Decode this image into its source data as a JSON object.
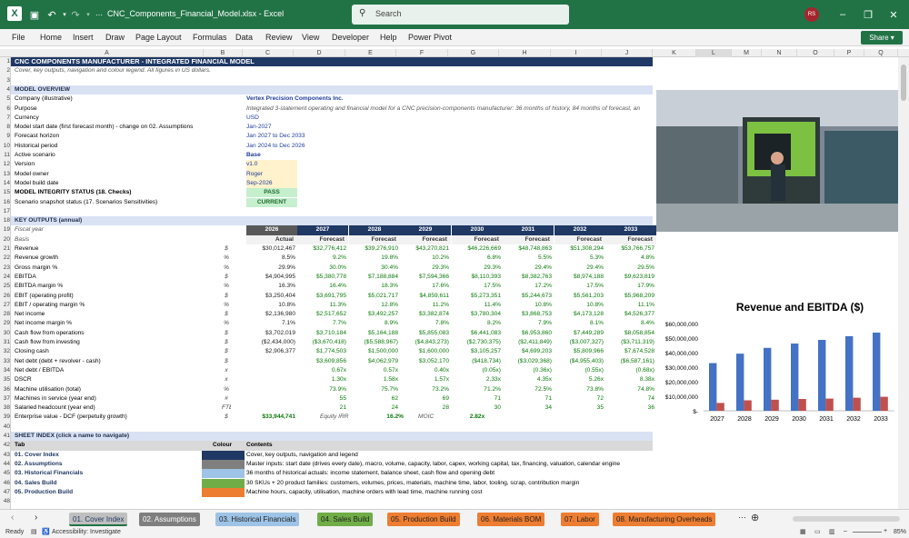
{
  "window": {
    "title": "CNC_Components_Financial_Model.xlsx  -  Excel",
    "search_placeholder": "Search",
    "user_initials": "RS"
  },
  "menu": [
    "File",
    "Home",
    "Insert",
    "Draw",
    "Page Layout",
    "Formulas",
    "Data",
    "Review",
    "View",
    "Developer",
    "Help",
    "Power Pivot"
  ],
  "share_label": "Share",
  "columns": [
    "A",
    "B",
    "C",
    "D",
    "E",
    "F",
    "G",
    "H",
    "I",
    "J",
    "K",
    "L",
    "M",
    "N",
    "O",
    "P",
    "Q"
  ],
  "rows": {
    "r1": "CNC COMPONENTS MANUFACTURER - INTEGRATED FINANCIAL MODEL",
    "r2": "Cover, key outputs, navigation and colour legend. All figures in US dollars.",
    "r4": "MODEL OVERVIEW",
    "overview": [
      {
        "n": "5",
        "l": "Company (illustrative)",
        "v": "Vertex Precision Components Inc."
      },
      {
        "n": "6",
        "l": "Purpose",
        "v": "Integrated 3-statement operating and financial model for a CNC precision-components manufacturer: 36 months of history, 84 months of forecast, an"
      },
      {
        "n": "7",
        "l": "Currency",
        "v": "USD"
      },
      {
        "n": "8",
        "l": "Model start date (first forecast month) - change on 02. Assumptions",
        "v": "Jan-2027"
      },
      {
        "n": "9",
        "l": "Forecast horizon",
        "v": "Jan 2027 to Dec 2033"
      },
      {
        "n": "10",
        "l": "Historical period",
        "v": "Jan 2024 to Dec 2026"
      },
      {
        "n": "11",
        "l": "Active scenario",
        "v": "Base"
      },
      {
        "n": "12",
        "l": "Version",
        "v": "v1.0"
      },
      {
        "n": "13",
        "l": "Model owner",
        "v": "Roger"
      },
      {
        "n": "14",
        "l": "Model build date",
        "v": "Sep-2026"
      },
      {
        "n": "15",
        "l": "MODEL INTEGRITY STATUS (18. Checks)",
        "v": "PASS"
      },
      {
        "n": "16",
        "l": "Scenario snapshot status (17. Scenarios Sensitivities)",
        "v": "CURRENT"
      }
    ],
    "r18": "KEY OUTPUTS (annual)",
    "fiscal_label": "Fiscal year",
    "basis_label": "Basis",
    "years": [
      "2026",
      "2027",
      "2028",
      "2029",
      "2030",
      "2031",
      "2032",
      "2033"
    ],
    "basis": [
      "Actual",
      "Forecast",
      "Forecast",
      "Forecast",
      "Forecast",
      "Forecast",
      "Forecast",
      "Forecast"
    ],
    "metrics": [
      {
        "n": "21",
        "l": "Revenue",
        "u": "$",
        "v": [
          "$30,012,467",
          "$32,776,412",
          "$39,276,910",
          "$43,270,821",
          "$46,226,669",
          "$48,748,863",
          "$51,308,294",
          "$53,766,757"
        ]
      },
      {
        "n": "22",
        "l": "Revenue growth",
        "u": "%",
        "v": [
          "8.5%",
          "9.2%",
          "19.8%",
          "10.2%",
          "6.8%",
          "5.5%",
          "5.3%",
          "4.8%"
        ]
      },
      {
        "n": "23",
        "l": "Gross margin %",
        "u": "%",
        "v": [
          "29.9%",
          "30.0%",
          "30.4%",
          "29.3%",
          "29.3%",
          "29.4%",
          "29.4%",
          "29.5%"
        ]
      },
      {
        "n": "24",
        "l": "EBITDA",
        "u": "$",
        "v": [
          "$4,904,995",
          "$5,380,778",
          "$7,188,884",
          "$7,594,366",
          "$8,110,393",
          "$8,382,763",
          "$8,974,188",
          "$9,623,819"
        ]
      },
      {
        "n": "25",
        "l": "EBITDA margin %",
        "u": "%",
        "v": [
          "16.3%",
          "16.4%",
          "18.3%",
          "17.6%",
          "17.5%",
          "17.2%",
          "17.5%",
          "17.9%"
        ]
      },
      {
        "n": "26",
        "l": "EBIT (operating profit)",
        "u": "$",
        "v": [
          "$3,250,404",
          "$3,691,795",
          "$5,021,717",
          "$4,859,611",
          "$5,273,351",
          "$5,244,673",
          "$5,561,203",
          "$5,968,209"
        ]
      },
      {
        "n": "27",
        "l": "EBIT / operating margin %",
        "u": "%",
        "v": [
          "10.8%",
          "11.3%",
          "12.8%",
          "11.2%",
          "11.4%",
          "10.8%",
          "10.8%",
          "11.1%"
        ]
      },
      {
        "n": "28",
        "l": "Net income",
        "u": "$",
        "v": [
          "$2,136,980",
          "$2,517,652",
          "$3,492,257",
          "$3,382,874",
          "$3,780,304",
          "$3,868,753",
          "$4,173,128",
          "$4,526,377"
        ]
      },
      {
        "n": "29",
        "l": "Net income margin %",
        "u": "%",
        "v": [
          "7.1%",
          "7.7%",
          "8.9%",
          "7.8%",
          "8.2%",
          "7.9%",
          "8.1%",
          "8.4%"
        ]
      },
      {
        "n": "30",
        "l": "Cash flow from operations",
        "u": "$",
        "v": [
          "$3,702,019",
          "$3,710,184",
          "$5,164,188",
          "$5,855,083",
          "$6,441,083",
          "$6,953,860",
          "$7,449,289",
          "$8,058,854"
        ]
      },
      {
        "n": "31",
        "l": "Cash flow from investing",
        "u": "$",
        "v": [
          "($2,434,000)",
          "($3,670,418)",
          "($5,588,967)",
          "($4,843,273)",
          "($2,730,375)",
          "($2,411,849)",
          "($3,007,327)",
          "($3,711,319)"
        ]
      },
      {
        "n": "32",
        "l": "Closing cash",
        "u": "$",
        "v": [
          "$2,906,377",
          "$1,774,503",
          "$1,500,000",
          "$1,600,000",
          "$3,105,257",
          "$4,699,203",
          "$5,809,966",
          "$7,674,528"
        ]
      },
      {
        "n": "33",
        "l": "Net debt (debt + revolver - cash)",
        "u": "$",
        "v": [
          "",
          "$3,609,856",
          "$4,062,979",
          "$3,052,170",
          "($418,734)",
          "($3,029,368)",
          "($4,955,403)",
          "($6,587,161)"
        ]
      },
      {
        "n": "34",
        "l": "Net debt / EBITDA",
        "u": "x",
        "v": [
          "",
          "0.67x",
          "0.57x",
          "0.40x",
          "(0.05x)",
          "(0.36x)",
          "(0.55x)",
          "(0.68x)"
        ]
      },
      {
        "n": "35",
        "l": "DSCR",
        "u": "x",
        "v": [
          "",
          "1.30x",
          "1.58x",
          "1.57x",
          "2.33x",
          "4.35x",
          "5.26x",
          "8.38x"
        ]
      },
      {
        "n": "36",
        "l": "Machine utilisation (total)",
        "u": "%",
        "v": [
          "",
          "73.9%",
          "75.7%",
          "73.2%",
          "71.2%",
          "72.5%",
          "73.8%",
          "74.8%"
        ]
      },
      {
        "n": "37",
        "l": "Machines in service (year end)",
        "u": "#",
        "v": [
          "",
          "55",
          "62",
          "69",
          "71",
          "71",
          "72",
          "74"
        ]
      },
      {
        "n": "38",
        "l": "Salaried headcount (year end)",
        "u": "FTE",
        "v": [
          "",
          "21",
          "24",
          "28",
          "30",
          "34",
          "35",
          "36"
        ]
      }
    ],
    "r39": {
      "l": "Enterprise value - DCF (perpetuity growth)",
      "u": "$",
      "ev": "$33,944,741",
      "irr_label": "Equity IRR",
      "irr": "16.2%",
      "moic_label": "MOIC",
      "moic": "2.82x"
    },
    "r41": "SHEET INDEX (click a name to navigate)",
    "idx_head": {
      "tab": "Tab",
      "colour": "Colour",
      "contents": "Contents"
    },
    "index": [
      {
        "n": "43",
        "t": "01. Cover Index",
        "c": "#1f3864",
        "d": "Cover, key outputs, navigation and legend"
      },
      {
        "n": "44",
        "t": "02. Assumptions",
        "c": "#7f7f7f",
        "d": "Master inputs: start date (drives every date), macro, volume, capacity, labor, capex, working capital, tax, financing, valuation, calendar engine"
      },
      {
        "n": "45",
        "t": "03. Historical Financials",
        "c": "#9dc3e6",
        "d": "36 months of historical actuals: income statement, balance sheet, cash flow and opening debt"
      },
      {
        "n": "46",
        "t": "04. Sales Build",
        "c": "#70ad47",
        "d": "30 SKUs + 20 product families: customers, volumes, prices, materials, machine time, labor, tooling, scrap, contribution margin"
      },
      {
        "n": "47",
        "t": "05. Production Build",
        "c": "#ed7d31",
        "d": "Machine hours, capacity, utilisation, machine orders with lead time, machine running cost"
      }
    ]
  },
  "chart_data": {
    "type": "bar",
    "title": "Revenue and EBITDA ($)",
    "categories": [
      "2027",
      "2028",
      "2029",
      "2030",
      "2031",
      "2032",
      "2033"
    ],
    "series": [
      {
        "name": "Revenue",
        "color": "#4472c4",
        "values": [
          32776412,
          39276910,
          43270821,
          46226669,
          48748863,
          51308294,
          53766757
        ]
      },
      {
        "name": "EBITDA",
        "color": "#c0504d",
        "values": [
          5380778,
          7188884,
          7594366,
          8110393,
          8382763,
          8974188,
          9623819
        ]
      }
    ],
    "ylim": [
      0,
      60000000
    ],
    "yticks": [
      "$60,000,000",
      "$50,000,000",
      "$40,000,000",
      "$30,000,000",
      "$20,000,000",
      "$10,000,000",
      "$-"
    ]
  },
  "tabs": [
    {
      "label": "01. Cover Index",
      "bg": "#bfbfbf",
      "fg": "#1f3864"
    },
    {
      "label": "02. Assumptions",
      "bg": "#7f7f7f",
      "fg": "#ffffff"
    },
    {
      "label": "03. Historical Financials",
      "bg": "#9dc3e6",
      "fg": "#1f1f1f"
    },
    {
      "label": "04. Sales Build",
      "bg": "#70ad47",
      "fg": "#1f1f1f"
    },
    {
      "label": "05. Production Build",
      "bg": "#ed7d31",
      "fg": "#1f1f1f"
    },
    {
      "label": "06. Materials BOM",
      "bg": "#ed7d31",
      "fg": "#1f1f1f"
    },
    {
      "label": "07. Labor",
      "bg": "#ed7d31",
      "fg": "#1f1f1f"
    },
    {
      "label": "08. Manufacturing Overheads",
      "bg": "#ed7d31",
      "fg": "#1f1f1f"
    }
  ],
  "status": {
    "ready": "Ready",
    "accessibility": "Accessibility: Investigate",
    "zoom": "85%"
  }
}
